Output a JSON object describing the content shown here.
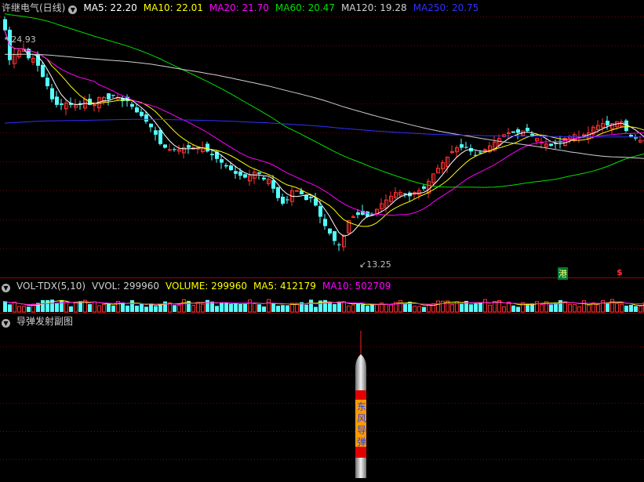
{
  "main_header": {
    "stock": "许继电气(日线)",
    "ma5": "MA5: 22.20",
    "ma10": "MA10: 22.01",
    "ma20": "MA20: 21.70",
    "ma60": "MA60: 20.47",
    "ma120": "MA120: 19.28",
    "ma250": "MA250: 20.75"
  },
  "vol_header": {
    "name": "VOL-TDX(5,10)",
    "vvol": "VVOL: 299960",
    "volume": "VOLUME: 299960",
    "ma5": "MA5: 412179",
    "ma10": "MA10: 502709"
  },
  "sub_header": {
    "name": "导弹发射副图"
  },
  "markers": {
    "high": "24.93",
    "low": "13.25",
    "hk": "港",
    "dollar": "$"
  },
  "missile": {
    "text": [
      "东",
      "风",
      "导",
      "弹"
    ]
  },
  "colors": {
    "up": "#ff3232",
    "down": "#54ffff",
    "ma5": "#ffffff",
    "ma10": "#ffff00",
    "ma20": "#ff00ff",
    "ma60": "#00e000",
    "ma120": "#d0d0d0",
    "ma250": "#3030ff",
    "grid": "#7a0000",
    "sep": "#a00000"
  },
  "chart_data": {
    "type": "candlestick",
    "x": [
      1,
      2,
      3,
      4,
      5,
      6,
      7,
      8,
      9,
      10,
      11,
      12,
      13,
      14,
      15,
      16,
      17,
      18,
      19,
      20,
      21,
      22,
      23,
      24,
      25,
      26,
      27,
      28,
      29,
      30,
      31,
      32,
      33,
      34,
      35,
      36,
      37,
      38,
      39,
      40,
      41,
      42,
      43,
      44,
      45,
      46,
      47,
      48,
      49,
      50,
      51,
      52,
      53,
      54,
      55,
      56,
      57,
      58,
      59,
      60,
      61,
      62,
      63,
      64,
      65,
      66,
      67,
      68,
      69,
      70,
      71,
      72,
      73,
      74,
      75,
      76,
      77,
      78,
      79,
      80,
      81,
      82,
      83,
      84,
      85,
      86,
      87,
      88,
      89,
      90,
      91,
      92,
      93,
      94,
      95,
      96,
      97,
      98,
      99,
      100,
      101,
      102,
      103,
      104,
      105,
      106,
      107,
      108,
      109,
      110,
      111,
      112,
      113,
      114,
      115,
      116,
      117,
      118,
      119,
      120,
      121,
      122,
      123,
      124,
      125,
      126,
      127,
      128,
      129,
      130,
      131,
      132,
      133,
      134,
      135,
      136,
      137
    ],
    "close": [
      24.9,
      23.3,
      23.6,
      23.8,
      23.9,
      23.4,
      23.4,
      23.0,
      22.4,
      21.9,
      21.2,
      20.9,
      20.9,
      21.0,
      20.9,
      20.9,
      20.9,
      21.2,
      20.9,
      20.9,
      21.3,
      21.3,
      21.2,
      21.4,
      21.3,
      21.1,
      21.1,
      20.8,
      20.5,
      20.3,
      20.0,
      19.7,
      19.3,
      18.8,
      18.6,
      18.5,
      18.5,
      18.5,
      18.6,
      18.6,
      18.6,
      18.6,
      18.6,
      18.4,
      18.2,
      18.0,
      17.8,
      17.6,
      17.4,
      17.2,
      17.1,
      17.0,
      17.1,
      17.3,
      17.2,
      16.9,
      16.9,
      16.4,
      15.9,
      15.6,
      15.8,
      16.3,
      16.3,
      16.1,
      15.8,
      15.9,
      15.5,
      14.9,
      14.4,
      14.0,
      13.6,
      13.4,
      13.9,
      14.7,
      14.9,
      15.0,
      15.0,
      14.9,
      15.0,
      15.3,
      15.6,
      15.8,
      16.0,
      16.2,
      16.2,
      16.1,
      16.0,
      16.2,
      16.3,
      16.4,
      16.8,
      17.2,
      17.5,
      17.8,
      18.1,
      18.4,
      18.6,
      18.6,
      18.6,
      18.4,
      18.2,
      18.3,
      18.5,
      18.7,
      18.9,
      19.1,
      19.3,
      19.4,
      19.4,
      19.4,
      19.5,
      19.5,
      19.2,
      19.1,
      18.9,
      18.8,
      18.7,
      18.8,
      18.9,
      19.1,
      19.2,
      19.3,
      19.2,
      19.3,
      19.4,
      19.7,
      19.8,
      19.9,
      19.8,
      19.9,
      20.0,
      20.0,
      19.5,
      19.2,
      19.1,
      19.0,
      19.0
    ],
    "ylim": [
      12.4,
      25.6
    ]
  }
}
